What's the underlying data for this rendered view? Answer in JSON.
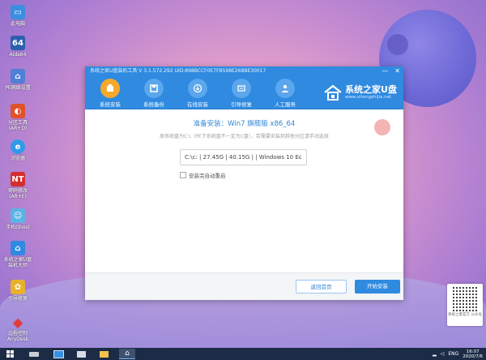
{
  "desktop": {
    "icons": [
      {
        "label": "此电脑",
        "icon": "computer-icon",
        "color": "#3a8fe0"
      },
      {
        "label": "Aida64",
        "icon": "aida64-icon",
        "color": "#2c5fae"
      },
      {
        "label": "PE网络设置",
        "icon": "network-settings-icon",
        "color": "#4f7fd6"
      },
      {
        "label": "分区工具 (AR+D)",
        "icon": "partition-tool-icon",
        "color": "#e0522c"
      },
      {
        "label": "浏览器",
        "icon": "browser-icon",
        "color": "#2f9ae8"
      },
      {
        "label": "密码修改 (AR+E)",
        "icon": "password-tool-icon",
        "color": "#d22f2f"
      },
      {
        "label": "手机Ghost",
        "icon": "ghost-icon",
        "color": "#5bb4e6"
      },
      {
        "label": "系统之家U盘 装机大师",
        "icon": "installer-icon",
        "color": "#2f8ae0"
      },
      {
        "label": "引导修复",
        "icon": "boot-repair-icon",
        "color": "#e8b12c"
      },
      {
        "label": "远程控制 AnyDesk",
        "icon": "anydesk-icon",
        "color": "#e23b3b"
      }
    ]
  },
  "window": {
    "title": "系统之家U盘装机工具 V 3.1.572.292 UID:898BCCF0E7FB598E26B8E30017",
    "minimize": "—",
    "close": "✕",
    "tabs": [
      {
        "label": "系统安装",
        "icon": "install-icon",
        "active": true
      },
      {
        "label": "系统备份",
        "icon": "backup-icon",
        "active": false
      },
      {
        "label": "在线安装",
        "icon": "online-install-icon",
        "active": false
      },
      {
        "label": "引导修复",
        "icon": "repair-icon",
        "active": false
      },
      {
        "label": "人工服务",
        "icon": "support-icon",
        "active": false
      }
    ],
    "logo": {
      "name": "系统之家U盘",
      "url": "www.xitongzhijia.net"
    },
    "heading": "准备安装：Win7 旗舰版 x86_64",
    "subtext": "原系统盘为C:\\（PE下系统盘不一定为C盘），若需要安装到其他分区请手动选择",
    "partition_select": "C:\\c: | 27.45G | 40.15G | | Windows 10 Ec",
    "checkbox_label": "安装完自动重启",
    "back_button": "返回首页",
    "start_button": "开始安装"
  },
  "qr": {
    "label": "系统之家官方 公众号"
  },
  "taskbar": {
    "clock_time": "16:07",
    "clock_date": "2020/7/6",
    "ime": "ENG"
  },
  "colors": {
    "accent": "#2f8ae0",
    "active_tab": "#f4a92d"
  }
}
